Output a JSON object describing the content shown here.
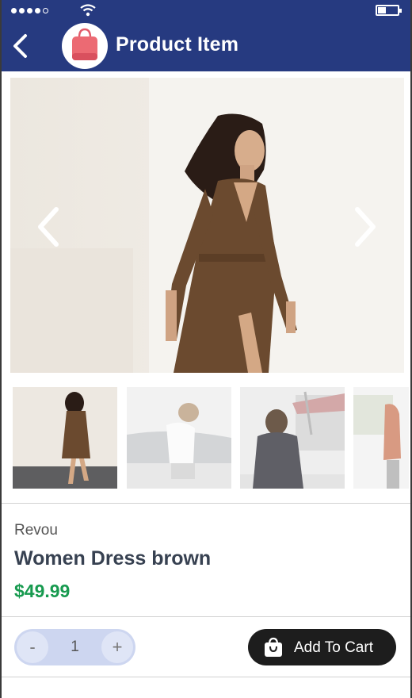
{
  "status_bar": {
    "signal_bars": 4,
    "signal_total": 5,
    "battery_level": 0.35
  },
  "header": {
    "title": "Product Item",
    "back_icon": "chevron-left-icon",
    "logo_icon": "shopping-bag-icon"
  },
  "colors": {
    "header_bg": "#263a80",
    "price": "#179a4f",
    "cart_button_bg": "#1d1d1d",
    "qty_bg": "#cdd6f0"
  },
  "gallery": {
    "prev_icon": "chevron-left-icon",
    "next_icon": "chevron-right-icon",
    "thumbnail_count": 4
  },
  "product": {
    "brand": "Revou",
    "name": "Women Dress brown",
    "price": "$49.99"
  },
  "quantity": {
    "minus_label": "-",
    "value": "1",
    "plus_label": "+"
  },
  "cart": {
    "label": "Add To Cart",
    "icon": "shopping-bag-icon"
  }
}
